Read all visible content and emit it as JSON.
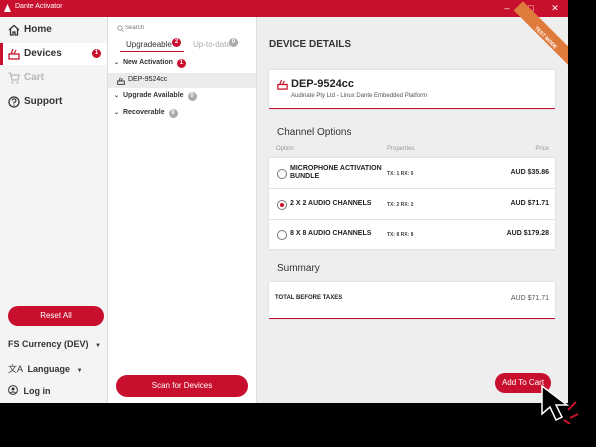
{
  "window": {
    "title": "Dante Activator",
    "minimize": "–",
    "maximize": "□",
    "close": "✕"
  },
  "sidebar": {
    "items": [
      {
        "label": "Home",
        "icon": "home-icon"
      },
      {
        "label": "Devices",
        "icon": "device-icon",
        "badge": "1"
      },
      {
        "label": "Cart",
        "icon": "cart-icon"
      },
      {
        "label": "Support",
        "icon": "help-icon"
      }
    ],
    "reset_label": "Reset All",
    "currency_label": "FS Currency (DEV)",
    "language_label": "Language",
    "login_label": "Log in"
  },
  "device_list": {
    "search_placeholder": "Search",
    "tabs": [
      {
        "label": "Upgradeable",
        "badge": "2"
      },
      {
        "label": "Up-to-date",
        "badge": "0"
      }
    ],
    "groups": [
      {
        "label": "New Activation",
        "badge": "1"
      },
      {
        "label": "Upgrade Available",
        "badge": "0"
      },
      {
        "label": "Recoverable",
        "badge": "0"
      }
    ],
    "device_item": "DEP-9524cc",
    "scan_label": "Scan for Devices"
  },
  "details": {
    "header": "DEVICE DETAILS",
    "test_mode": "TEST MODE",
    "device_name": "DEP-9524cc",
    "device_sub": "Audinate Pty Ltd - Linux Dante Embedded Platform",
    "channel_options_title": "Channel Options",
    "col_option": "Option",
    "col_properties": "Properties",
    "col_price": "Price",
    "options": [
      {
        "name": "MICROPHONE ACTIVATION BUNDLE",
        "props": "TX: 1   RX: 0",
        "price": "AUD $35.86",
        "selected": false
      },
      {
        "name": "2 X 2 AUDIO CHANNELS",
        "props": "TX: 2   RX: 2",
        "price": "AUD $71.71",
        "selected": true
      },
      {
        "name": "8 X 8 AUDIO CHANNELS",
        "props": "TX: 8   RX: 8",
        "price": "AUD $179.28",
        "selected": false
      }
    ],
    "summary_title": "Summary",
    "total_label": "TOTAL BEFORE TAXES",
    "total_value": "AUD $71.71",
    "add_to_cart": "Add To Cart"
  },
  "colors": {
    "accent": "#c8102e",
    "sidebar_bg": "#f4f4f4",
    "content_bg": "#eeeeee"
  }
}
